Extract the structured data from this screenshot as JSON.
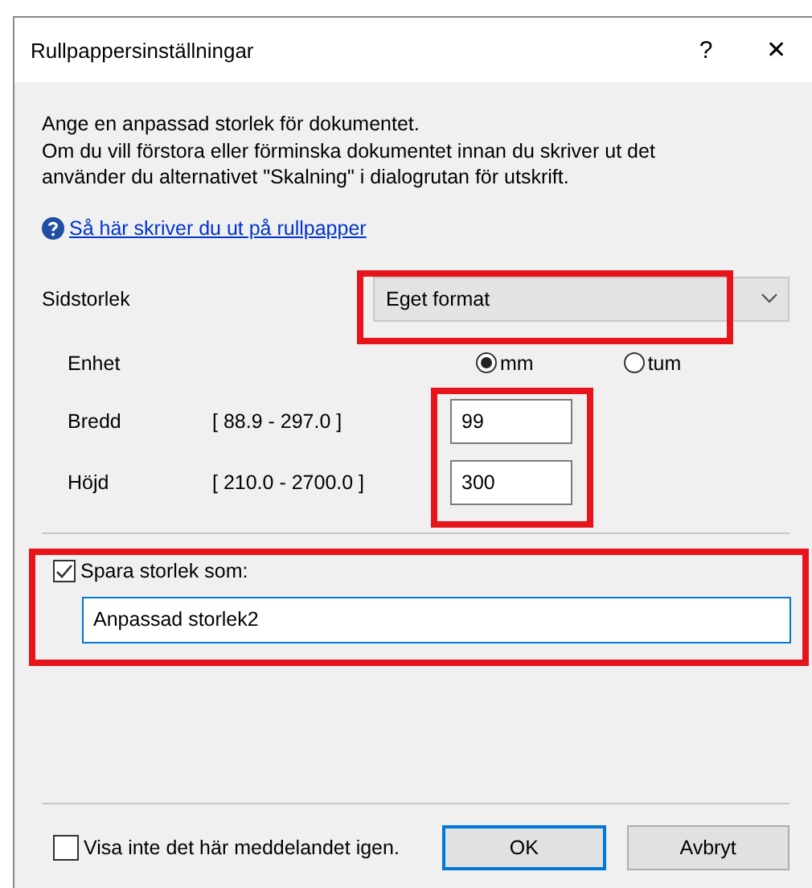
{
  "window": {
    "title": "Rullpappersinställningar",
    "help_button": "?",
    "close_button": "✕"
  },
  "intro": [
    "Ange en anpassad storlek för dokumentet.",
    "Om du vill förstora eller förminska dokumentet innan du skriver ut det",
    "använder du alternativet \"Skalning\" i dialogrutan för utskrift."
  ],
  "help_link": "Så här skriver du ut på rullpapper",
  "page_size": {
    "label": "Sidstorlek",
    "value": "Eget format",
    "highlighted": true
  },
  "unit": {
    "label": "Enhet",
    "options": [
      {
        "label": "mm",
        "selected": true
      },
      {
        "label": "tum",
        "selected": false
      }
    ]
  },
  "dimensions": {
    "highlighted": true,
    "rows": [
      {
        "label": "Bredd",
        "range": "[ 88.9 - 297.0 ]",
        "value": "99"
      },
      {
        "label": "Höjd",
        "range": "[ 210.0 - 2700.0 ]",
        "value": "300"
      }
    ]
  },
  "save_size": {
    "label": "Spara storlek som:",
    "checked": true,
    "value": "Anpassad storlek2",
    "highlighted": true
  },
  "dont_show": {
    "label": "Visa inte det här meddelandet igen.",
    "checked": false
  },
  "buttons": [
    {
      "label": "OK",
      "default": true
    },
    {
      "label": "Avbryt",
      "default": false
    }
  ]
}
